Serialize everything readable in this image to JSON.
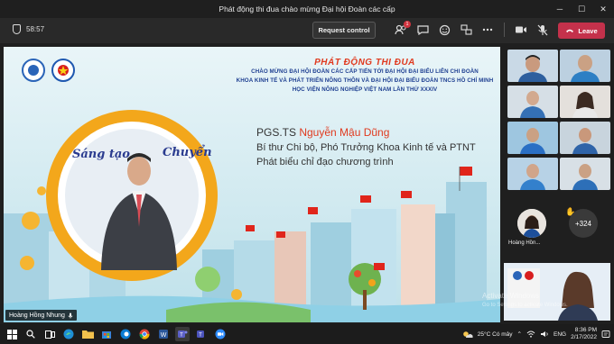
{
  "window": {
    "title": "Phát động thi đua chào mừng Đại hội Đoàn các cấp"
  },
  "toolbar": {
    "timer": "58:57",
    "request_control": "Request control",
    "participants_badge": "1",
    "leave_label": "Leave"
  },
  "slide": {
    "title": "PHÁT ĐỘNG THI ĐUA",
    "lines": [
      "CHÀO MỪNG ĐẠI HỘI ĐOÀN CÁC CẤP TIẾN TỚI ĐẠI HỘI ĐẠI BIỂU LIÊN CHI ĐOÀN",
      "KHOA KINH TẾ VÀ PHÁT TRIỂN NÔNG THÔN VÀ ĐẠI HỘI ĐẠI BIỂU ĐOÀN TNCS HỒ CHÍ MINH",
      "HỌC VIỆN NÔNG NGHIỆP VIỆT NAM LẦN THỨ XXXIV"
    ],
    "speaker_prefix": "PGS.TS ",
    "speaker_name": "Nguyễn Mậu Dũng",
    "speaker_role": "Bí thư Chi bộ, Phó Trưởng Khoa Kinh tế và PTNT",
    "speaker_action": "Phát biểu chỉ đạo chương trình",
    "banner_left": "Sáng tạo",
    "banner_right": "Chuyển"
  },
  "presenter_caption": "Hoàng Hồng Nhung",
  "gallery": {
    "avatar_name": "Hoàng Hồn...",
    "more_count": "+324"
  },
  "watermark": {
    "line1": "Activate Windows",
    "line2": "Go to Settings to activate Windows."
  },
  "taskbar": {
    "weather": "25°C  Có mây",
    "lang": "ENG",
    "time": "8:36 PM",
    "date": "2/17/2022"
  },
  "colors": {
    "leave": "#c4314b",
    "accent_red": "#e03a1f",
    "slide_blue": "#1e3f91"
  }
}
